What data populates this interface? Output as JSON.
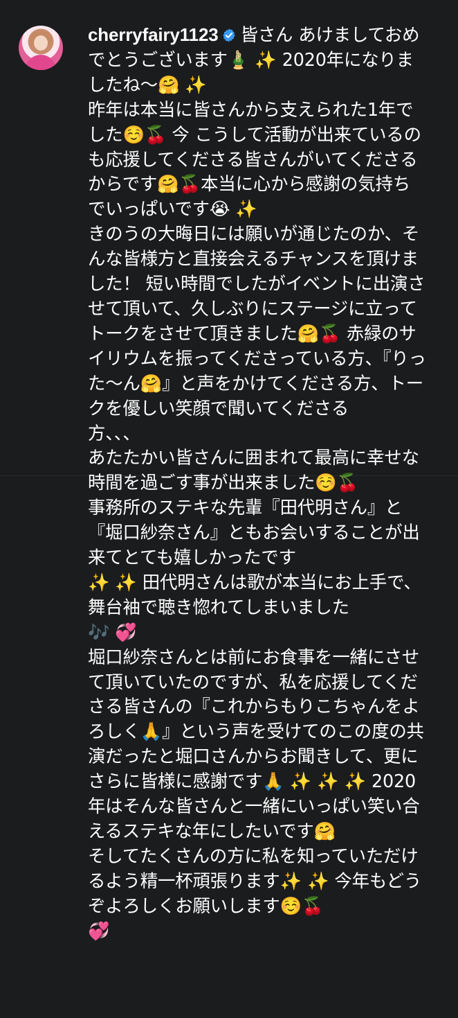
{
  "post": {
    "username": "cherryfairy1123",
    "verified_icon": "verified-badge-icon",
    "avatar_icon": "profile-avatar",
    "caption_head": "皆さん あけましておめでとうございます🎍 ✨ 2020年になりましたね〜🤗 ✨\n昨年は本当に皆さんから支えられた1年でした☺️🍒 今 こうして活動が出来ているのも応援してくださる皆さんがいてくださるからです🤗🍒本当に心から感謝の気持ちでいっぱいです😭 ✨\nきのうの大晦日には願いが通じたのか、そんな皆様方と直接会えるチャンスを頂けました！ 短い時間でしたがイベントに出演させて頂いて、久しぶりにステージに立ってトークをさせて頂きました🤗🍒 赤緑のサイリウムを振ってくださっている方、『りった〜ん🤗』と声をかけてくださる方、トークを優しい笑顔で聞いてくださる\n方、、、\n",
    "caption_tail": "あたたかい皆さんに囲まれて最高に幸せな時間を過ごす事が出来ました☺️🍒\n事務所のステキな先輩『田代明さん』と『堀口紗奈さん』ともお会いすることが出来てとても嬉しかったです\n✨ ✨ 田代明さんは歌が本当にお上手で、舞台袖で聴き惚れてしまいました\n🎶 💞\n堀口紗奈さんとは前にお食事を一緒にさせて頂いていたのですが、私を応援してくださる皆さんの『これからもりこちゃんをよろしく🙏』という声を受けてのこの度の共演だったと堀口さんからお聞きして、更にさらに皆様に感謝です🙏 ✨ ✨ ✨ 2020年はそんな皆さんと一緒にいっぱい笑い合えるステキな年にしたいです🤗\nそしてたくさんの方に私を知っていただけるよう精一杯頑張ります✨ ✨ 今年もどうぞよろしくお願いします☺️🍒\n💞"
  },
  "colors": {
    "background": "#1b1c1e",
    "text": "#ffffff",
    "verified": "#3897f0"
  }
}
